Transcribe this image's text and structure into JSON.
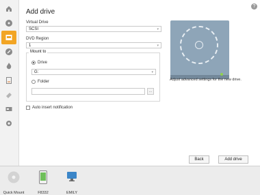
{
  "header": {
    "title": "Add drive",
    "help_icon": "help-icon"
  },
  "form": {
    "virtual_drive_label": "Virtual Drive",
    "virtual_drive_value": "SCSI",
    "dvd_region_label": "DVD Region",
    "dvd_region_value": "1",
    "mount_to_label": "Mount to",
    "drive_option_label": "Drive",
    "drive_value": "G:",
    "folder_option_label": "Folder",
    "folder_value": "",
    "browse_label": "...",
    "auto_insert_label": "Auto insert notification"
  },
  "preview": {
    "description": "Adjust advanced settings for the new drive."
  },
  "buttons": {
    "back": "Back",
    "add_drive": "Add drive"
  },
  "sidebar": {
    "items": [
      {
        "icon": "home-icon"
      },
      {
        "icon": "disc-icon"
      },
      {
        "icon": "drive-icon",
        "active": true
      },
      {
        "icon": "edit-icon"
      },
      {
        "icon": "burn-icon"
      },
      {
        "icon": "image-icon"
      },
      {
        "icon": "eraser-icon"
      },
      {
        "icon": "usb-icon"
      },
      {
        "icon": "settings-icon"
      }
    ]
  },
  "bottom_bar": {
    "items": [
      {
        "label": "Quick Mount",
        "icon": "quick-mount-icon"
      },
      {
        "label": "F8332",
        "icon": "phone-icon"
      },
      {
        "label": "EMILY",
        "icon": "computer-icon"
      }
    ]
  },
  "colors": {
    "accent": "#f2a524",
    "drive_bg": "#8ea5b8",
    "led": "#8fd14b"
  }
}
